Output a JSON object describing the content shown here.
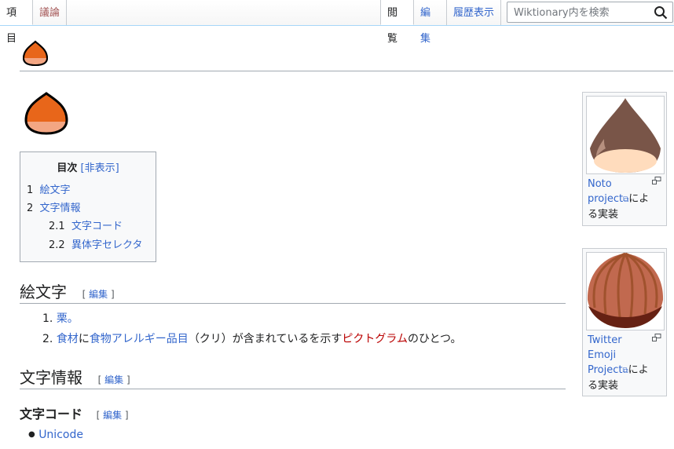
{
  "tabs": {
    "article": "項目",
    "talk": "議論",
    "read": "閲覧",
    "edit": "編集",
    "history": "履歴表示"
  },
  "search": {
    "placeholder": "Wiktionary内を検索",
    "icon": "search-icon"
  },
  "toc": {
    "title": "目次",
    "toggle": "[非表示]",
    "items": [
      {
        "number": "1",
        "label": "絵文字"
      },
      {
        "number": "2",
        "label": "文字情報"
      },
      {
        "number": "2.1",
        "label": "文字コード"
      },
      {
        "number": "2.2",
        "label": "異体字セレクタ"
      }
    ]
  },
  "sections": {
    "emoji": {
      "title": "絵文字",
      "edit": "編集",
      "items": [
        {
          "num": "1.",
          "text": "栗。"
        },
        {
          "num": "2.",
          "link1": "食材",
          "mid1": "に",
          "link2": "食物アレルギー品目",
          "mid2": "（クリ）が含まれているを示す",
          "link3": "ピクトグラム",
          "tail": "のひとつ。"
        }
      ]
    },
    "char_info": {
      "title": "文字情報",
      "edit": "編集"
    },
    "char_code": {
      "title": "文字コード",
      "edit": "編集",
      "items": [
        "Unicode"
      ]
    }
  },
  "thumbs": [
    {
      "link1": "Noto",
      "link2": "project",
      "tail": "によ",
      "tail2": "る実装"
    },
    {
      "link1": "Twitter",
      "link2": "Emoji",
      "link3": "Project",
      "tail": "によ",
      "tail2": "る実装"
    }
  ],
  "colors": {
    "chestnut_orange": "#e8661a",
    "link": "#3366cc",
    "redlink": "#a55858"
  }
}
